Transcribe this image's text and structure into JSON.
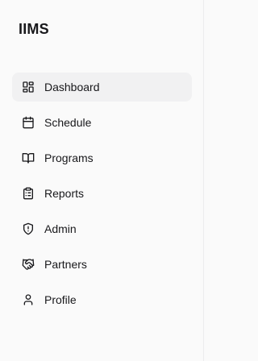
{
  "app": {
    "title": "IIMS"
  },
  "nav": {
    "items": [
      {
        "label": "Dashboard",
        "icon": "dashboard-icon",
        "active": true
      },
      {
        "label": "Schedule",
        "icon": "calendar-icon",
        "active": false
      },
      {
        "label": "Programs",
        "icon": "book-open-icon",
        "active": false
      },
      {
        "label": "Reports",
        "icon": "clipboard-list-icon",
        "active": false
      },
      {
        "label": "Admin",
        "icon": "shield-alert-icon",
        "active": false
      },
      {
        "label": "Partners",
        "icon": "handshake-icon",
        "active": false
      },
      {
        "label": "Profile",
        "icon": "user-icon",
        "active": false
      }
    ]
  },
  "colors": {
    "background": "#fafafa",
    "active_item": "#f1f1f2",
    "text": "#18181b"
  }
}
